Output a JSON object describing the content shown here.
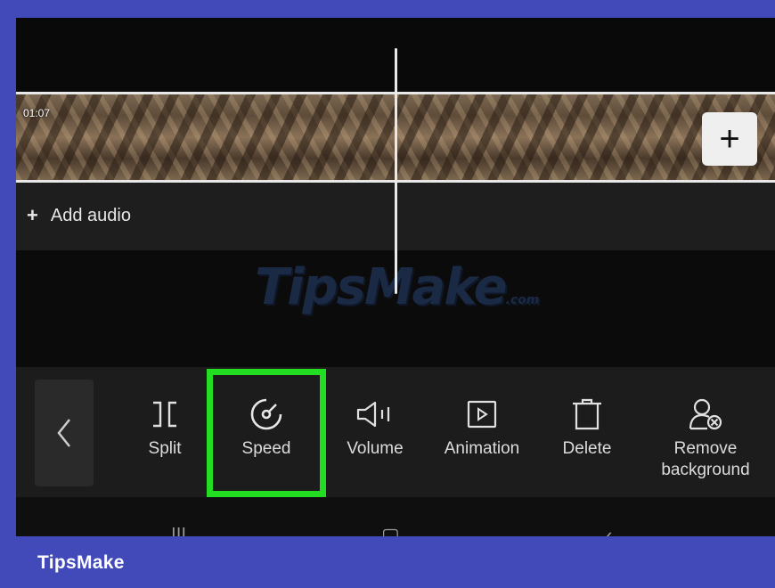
{
  "timeline": {
    "clip_time": "01:07",
    "add_clip_symbol": "+",
    "audio_plus": "+",
    "add_audio_label": "Add audio"
  },
  "watermark": {
    "text": "TipsMake",
    "suffix": ".com"
  },
  "toolbar": {
    "back_icon": "chevron-left-icon",
    "tools": [
      {
        "label": "Split",
        "icon": "split-icon"
      },
      {
        "label": "Speed",
        "icon": "speedometer-icon",
        "highlighted": true
      },
      {
        "label": "Volume",
        "icon": "speaker-icon"
      },
      {
        "label": "Animation",
        "icon": "animation-play-icon"
      },
      {
        "label": "Delete",
        "icon": "trash-icon"
      },
      {
        "label": "Remove\nbackground",
        "icon": "remove-background-icon"
      }
    ],
    "highlight_color": "#22dd22"
  },
  "navbar": {
    "recent": "|||",
    "home": "▢",
    "back": "‹"
  },
  "brand": {
    "name": "TipsMake",
    "frame_color": "#4249b8"
  }
}
